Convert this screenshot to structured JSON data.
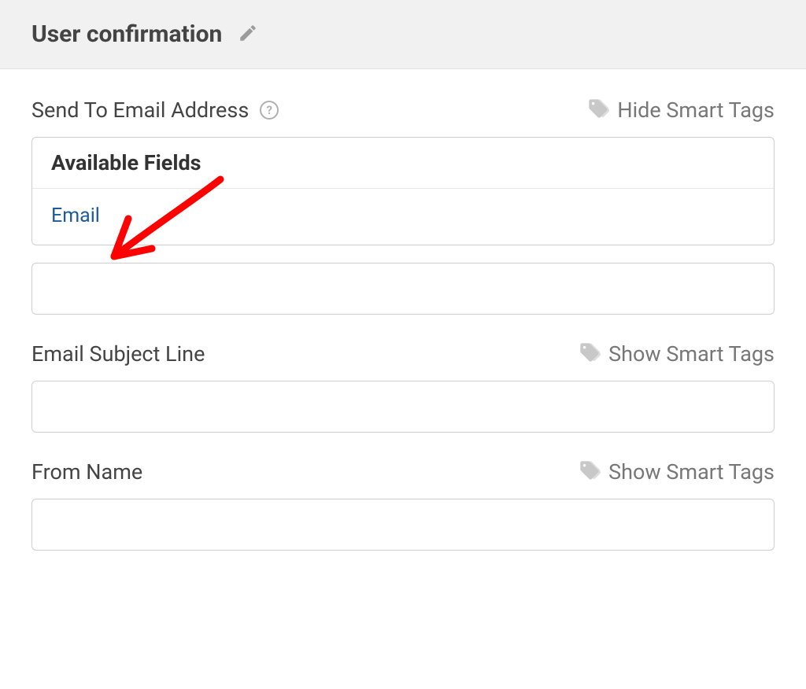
{
  "header": {
    "title": "User confirmation"
  },
  "sendTo": {
    "label": "Send To Email Address",
    "smartTagsToggle": "Hide Smart Tags",
    "panelTitle": "Available Fields",
    "fields": [
      "Email"
    ],
    "value": ""
  },
  "subject": {
    "label": "Email Subject Line",
    "smartTagsToggle": "Show Smart Tags",
    "value": ""
  },
  "fromName": {
    "label": "From Name",
    "smartTagsToggle": "Show Smart Tags",
    "value": ""
  }
}
